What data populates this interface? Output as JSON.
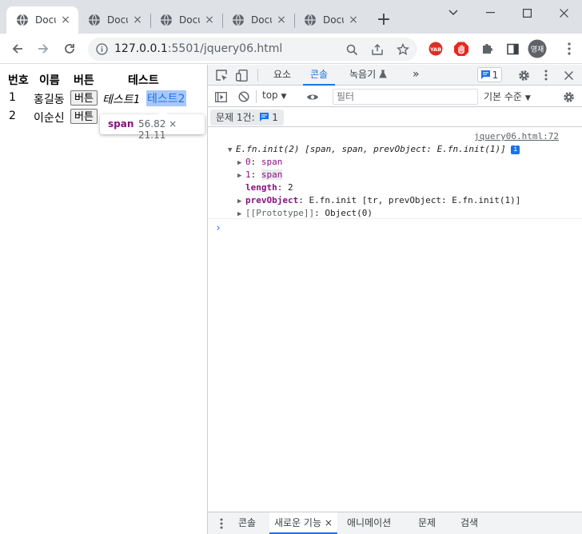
{
  "tabs": [
    {
      "title": "Document",
      "active": true,
      "close": "×"
    },
    {
      "title": "Document",
      "active": false,
      "close": "×"
    },
    {
      "title": "Document",
      "active": false,
      "close": "×"
    },
    {
      "title": "Document",
      "active": false,
      "close": "×"
    },
    {
      "title": "Document",
      "active": false,
      "close": "×"
    }
  ],
  "new_tab": "+",
  "window_controls": {
    "dropdown": "⌄",
    "minimize": "—",
    "maximize": "☐",
    "close": "✕"
  },
  "address": {
    "host": "127.0.0.1",
    "rest": ":5501/jquery06.html"
  },
  "extensions": {
    "yab": "YAB",
    "profile": "영재"
  },
  "page": {
    "headers": [
      "번호",
      "이름",
      "버튼",
      "테스트"
    ],
    "rows": [
      {
        "num": "1",
        "name": "홍길동",
        "button": "버튼",
        "test1": "테스트1",
        "test2": "테스트2"
      },
      {
        "num": "2",
        "name": "이순신",
        "button": "버튼"
      }
    ],
    "tooltip": {
      "tag": "span",
      "dims": "56.82 × 21.11"
    }
  },
  "devtools": {
    "tabs": [
      "요소",
      "콘솔",
      "녹음기"
    ],
    "more": "»",
    "issue_count": "1",
    "context": "top",
    "filter_placeholder": "필터",
    "level": "기본 수준",
    "issues_label": "문제 1건:",
    "issues_count": "1",
    "console": {
      "source": "jquery06.html:72",
      "summary": "E.fn.init(2) [span, span, prevObject: E.fn.init(1)]",
      "info_badge": "i",
      "items": [
        {
          "key": "0",
          "value": "span"
        },
        {
          "key": "1",
          "value": "span"
        }
      ],
      "length_key": "length",
      "length_val": "2",
      "prev_key": "prevObject",
      "prev_val": "E.fn.init [tr, prevObject: E.fn.init(1)]",
      "proto_key": "[[Prototype]]",
      "proto_val": "Object(0)",
      "prompt": "›"
    },
    "drawer": {
      "tabs": [
        "콘솔",
        "새로운 기능",
        "애니메이션",
        "문제",
        "검색"
      ],
      "close": "×"
    }
  }
}
